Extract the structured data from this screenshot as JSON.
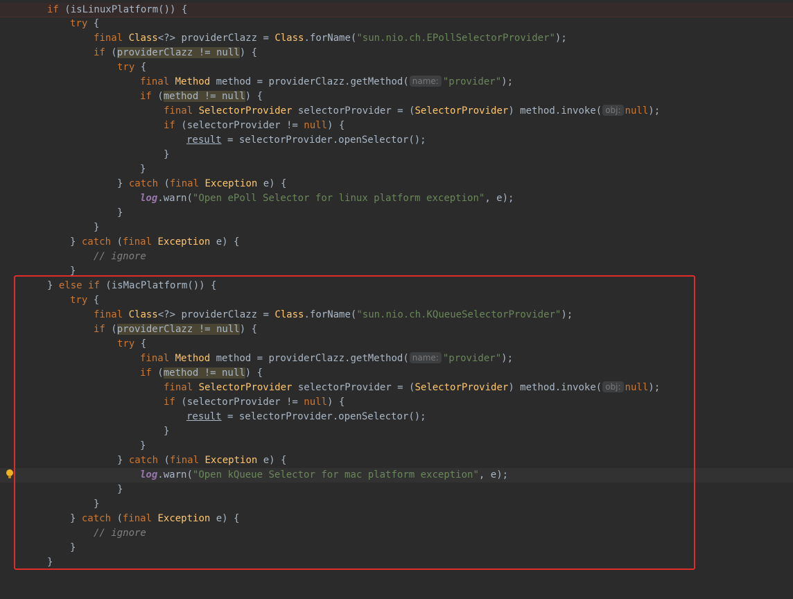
{
  "code": {
    "l1": {
      "kw_if": "if",
      "p1": " (",
      "call": "isLinuxPlatform",
      "p2": "()) {"
    },
    "l2": {
      "kw_try": "try",
      "p1": " {"
    },
    "l3": {
      "kw_final": "final",
      "ty": "Class",
      "p1": "<?> providerClazz = ",
      "ty2": "Class",
      "p2": ".forName(",
      "str": "\"sun.nio.ch.EPollSelectorProvider\"",
      "p3": ");"
    },
    "l4": {
      "kw_if": "if",
      "p1": " (",
      "occ": "providerClazz != null",
      "p2": ") {"
    },
    "l5": {
      "kw_try": "try",
      "p1": " {"
    },
    "l6": {
      "kw_final": "final",
      "ty": "Method",
      "p1": " method = providerClazz.",
      "meth": "getMethod",
      "p2": "(",
      "hint": "name:",
      "str": "\"provider\"",
      "p3": ");"
    },
    "l7": {
      "kw_if": "if",
      "p1": " (",
      "occ": "method != null",
      "p2": ") {"
    },
    "l8": {
      "kw_final": "final",
      "ty": "SelectorProvider",
      "p1": " selectorProvider = (",
      "ty2": "SelectorProvider",
      "p2": ") method.",
      "meth": "invoke",
      "p3": "(",
      "hint": "obj:",
      "kw_null": "null",
      "p4": ");"
    },
    "l9": {
      "kw_if": "if",
      "p1": " (selectorProvider != ",
      "kw_null": "null",
      "p2": ") {"
    },
    "l10": {
      "res": "result",
      "p1": " = selectorProvider.",
      "meth": "openSelector",
      "p2": "();"
    },
    "l11": {
      "p1": "}"
    },
    "l12": {
      "p1": "}"
    },
    "l13": {
      "p1": "} ",
      "kw_catch": "catch",
      "p2": " (",
      "kw_final": "final",
      "ty": "Exception",
      "p3": " e) {"
    },
    "l14": {
      "log": "log",
      "p1": ".",
      "meth": "warn",
      "p2": "(",
      "str": "\"Open ePoll Selector for linux platform exception\"",
      "p3": ", e);"
    },
    "l15": {
      "p1": "}"
    },
    "l16": {
      "p1": "}"
    },
    "l17": {
      "p1": "} ",
      "kw_catch": "catch",
      "p2": " (",
      "kw_final": "final",
      "ty": "Exception",
      "p3": " e) {"
    },
    "l18": {
      "cm": "// ignore"
    },
    "l19": {
      "p1": "}"
    },
    "l20": {
      "p1": "} ",
      "kw_else": "else",
      "p2": " ",
      "kw_if": "if",
      "p3": " (",
      "call": "isMacPlatform",
      "p4": "()) {"
    },
    "l21": {
      "kw_try": "try",
      "p1": " {"
    },
    "l22": {
      "kw_final": "final",
      "ty": "Class",
      "p1": "<?> providerClazz = ",
      "ty2": "Class",
      "p2": ".forName(",
      "str": "\"sun.nio.ch.KQueueSelectorProvider\"",
      "p3": ");"
    },
    "l23": {
      "kw_if": "if",
      "p1": " (",
      "occ": "providerClazz != null",
      "p2": ") {"
    },
    "l24": {
      "kw_try": "try",
      "p1": " {"
    },
    "l25": {
      "kw_final": "final",
      "ty": "Method",
      "p1": " method = providerClazz.",
      "meth": "getMethod",
      "p2": "(",
      "hint": "name:",
      "str": "\"provider\"",
      "p3": ");"
    },
    "l26": {
      "kw_if": "if",
      "p1": " (",
      "occ": "method != null",
      "p2": ") {"
    },
    "l27": {
      "kw_final": "final",
      "ty": "SelectorProvider",
      "p1": " selectorProvider = (",
      "ty2": "SelectorProvider",
      "p2": ") method.",
      "meth": "invoke",
      "p3": "(",
      "hint": "obj:",
      "kw_null": "null",
      "p4": ");"
    },
    "l28": {
      "kw_if": "if",
      "p1": " (selectorProvider != ",
      "kw_null": "null",
      "p2": ") {"
    },
    "l29": {
      "res": "result",
      "p1": " = selectorProvider.",
      "meth": "openSelector",
      "p2": "();"
    },
    "l30": {
      "p1": "}"
    },
    "l31": {
      "p1": "}"
    },
    "l32": {
      "p1": "} ",
      "kw_catch": "catch",
      "p2": " (",
      "kw_final": "final",
      "ty": "Exception",
      "p3": " e) {"
    },
    "l33": {
      "log": "log",
      "p1": ".",
      "meth": "warn",
      "p2": "(",
      "str": "\"Open kQueue Selector for mac platform exception\"",
      "p3": ", e);"
    },
    "l34": {
      "p1": "}"
    },
    "l35": {
      "p1": "}"
    },
    "l36": {
      "p1": "} ",
      "kw_catch": "catch",
      "p2": " (",
      "kw_final": "final",
      "ty": "Exception",
      "p3": " e) {"
    },
    "l37": {
      "cm": "// ignore"
    },
    "l38": {
      "p1": "}"
    },
    "l39": {
      "p1": "}"
    }
  },
  "icons": {
    "gutter_intention": "lightbulb-icon"
  },
  "colors": {
    "background": "#2b2b2b",
    "keyword": "#cc7832",
    "string": "#6a8759",
    "type": "#ffc66d",
    "comment": "#808080",
    "field": "#9876aa",
    "selection_frame": "#e02b2b"
  }
}
